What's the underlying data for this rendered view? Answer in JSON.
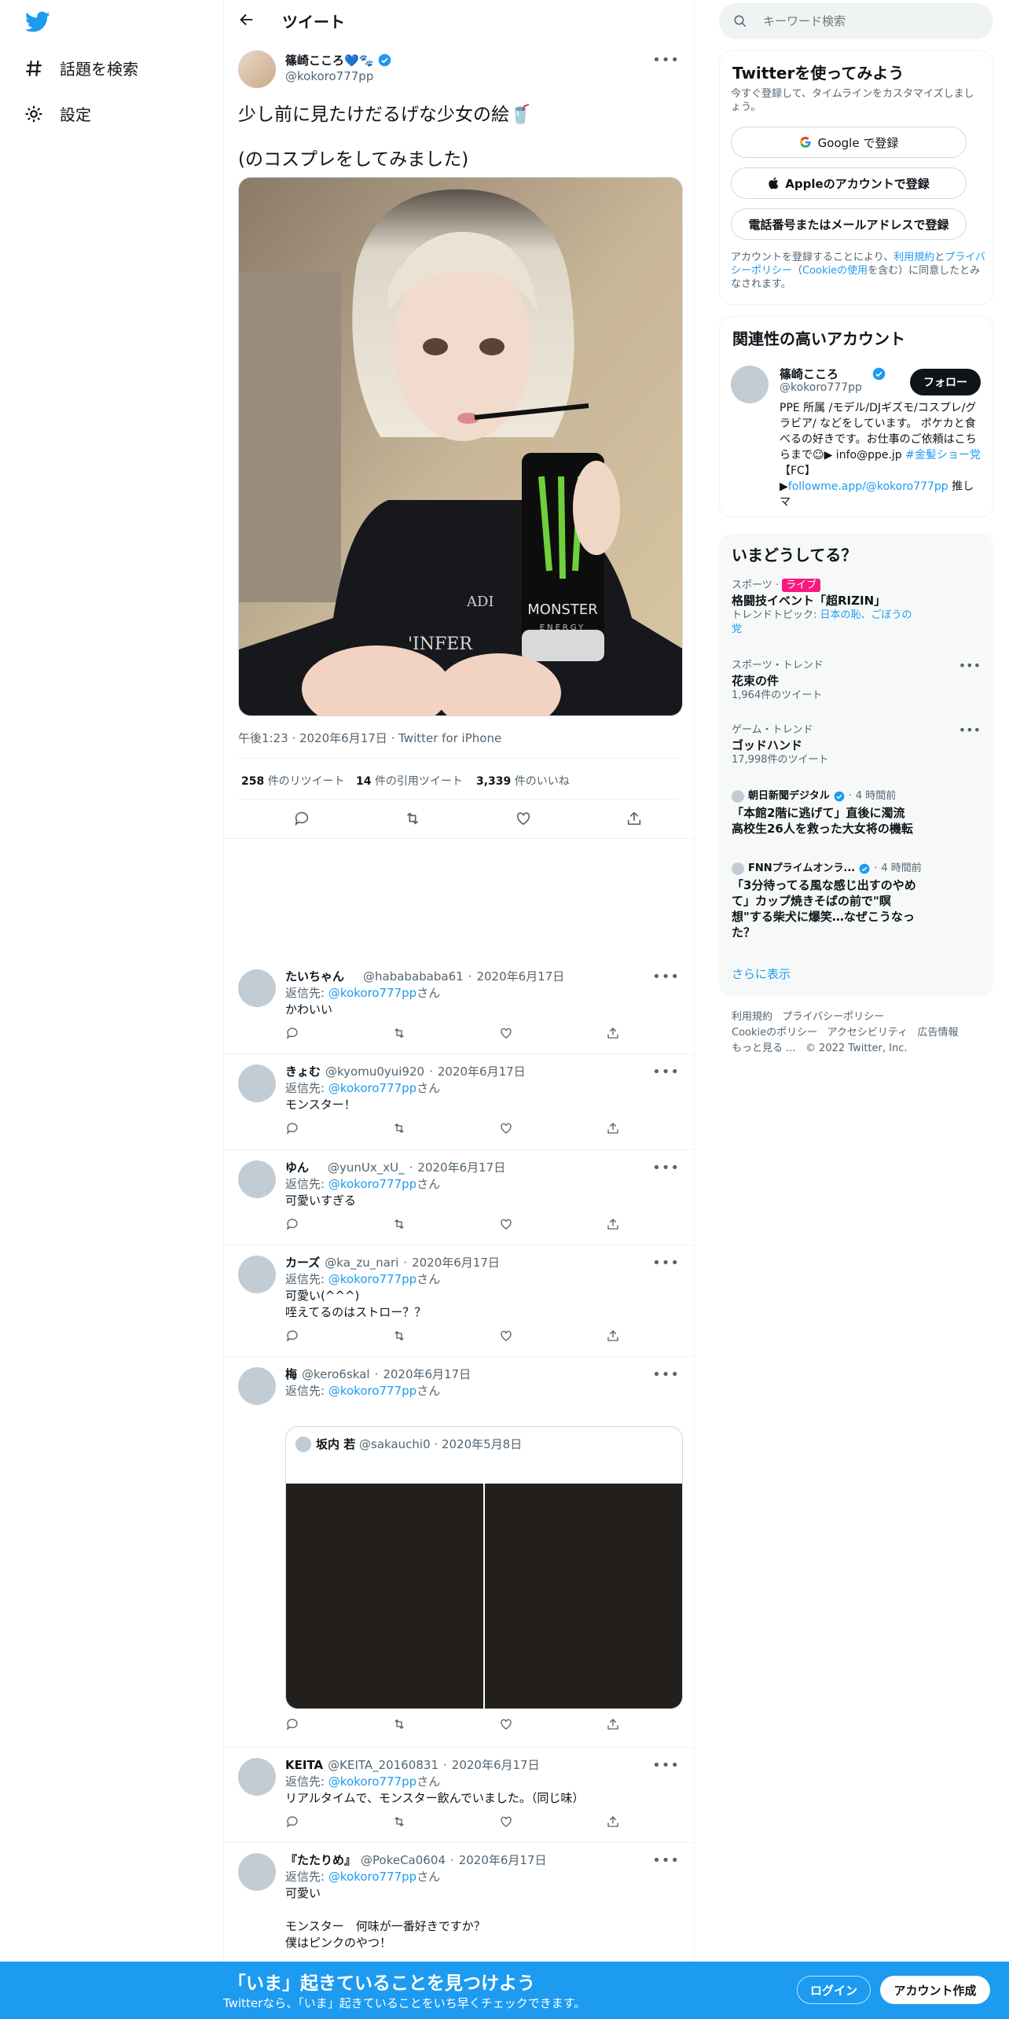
{
  "nav": {
    "explore_label": "話題を検索",
    "settings_label": "設定"
  },
  "header": {
    "title": "ツイート"
  },
  "tweet": {
    "display_name": "篠崎こころ💙🐾",
    "handle": "@kokoro777pp",
    "text_line1": "少し前に見たけだるげな少女の絵🥤",
    "text_line2": "(のコスプレをしてみました)",
    "image_text_1": "MONSTER",
    "image_text_2": "ENERGY",
    "image_text_3": "'INFER",
    "image_text_4": "ADI",
    "meta_time": "午後1:23",
    "meta_date": "2020年6月17日",
    "meta_source": "Twitter for iPhone",
    "stats": [
      {
        "count": "258",
        "label": "件のリツイート"
      },
      {
        "count": "14",
        "label": "件の引用ツイート"
      },
      {
        "count": "3,339",
        "label": "件のいいね"
      }
    ]
  },
  "replies": [
    {
      "name": "たいちゃん",
      "handle": "@hababababa61",
      "date": "2020年6月17日",
      "reply_prefix": "返信先:",
      "reply_to": "@kokoro777pp",
      "reply_suffix": "さん",
      "lines": [
        "かわいい"
      ]
    },
    {
      "name": "きょむ",
      "handle": "@kyomu0yui920",
      "date": "2020年6月17日",
      "reply_prefix": "返信先:",
      "reply_to": "@kokoro777pp",
      "reply_suffix": "さん",
      "lines": [
        "モンスター！"
      ]
    },
    {
      "name": "ゆん",
      "handle": "@yunUx_xU_",
      "date": "2020年6月17日",
      "reply_prefix": "返信先:",
      "reply_to": "@kokoro777pp",
      "reply_suffix": "さん",
      "lines": [
        "可愛いすぎる"
      ]
    },
    {
      "name": "カーズ",
      "handle": "@ka_zu_nari",
      "date": "2020年6月17日",
      "reply_prefix": "返信先:",
      "reply_to": "@kokoro777pp",
      "reply_suffix": "さん",
      "lines": [
        "可愛い(^^^)",
        "咥えてるのはストロー？？"
      ]
    },
    {
      "name": "梅",
      "handle": "@kero6skal",
      "date": "2020年6月17日",
      "reply_prefix": "返信先:",
      "reply_to": "@kokoro777pp",
      "reply_suffix": "さん",
      "lines": []
    },
    {
      "name": "KEITA",
      "handle": "@KEITA_20160831",
      "date": "2020年6月17日",
      "reply_prefix": "返信先:",
      "reply_to": "@kokoro777pp",
      "reply_suffix": "さん",
      "lines": [
        "リアルタイムで、モンスター飲んでいました。（同じ味）"
      ]
    },
    {
      "name": "『たたりめ』",
      "handle": "@PokeCa0604",
      "date": "2020年6月17日",
      "reply_prefix": "返信先:",
      "reply_to": "@kokoro777pp",
      "reply_suffix": "さん",
      "lines": [
        "可愛い",
        "",
        "モンスター　何味が一番好きですか？",
        "僕はピンクのやつ！"
      ]
    }
  ],
  "quoted": {
    "name": "坂内 若",
    "handle": "@sakauchi0",
    "date": "2020年5月8日"
  },
  "search": {
    "placeholder": "キーワード検索"
  },
  "signup": {
    "title": "Twitterを使ってみよう",
    "subtitle": "今すぐ登録して、タイムラインをカスタマイズしましょう。",
    "google_label": "Google で登録",
    "apple_label": "Appleのアカウントで登録",
    "phone_label": "電話番号またはメールアドレスで登録",
    "legal_1": "アカウントを登録することにより、",
    "legal_terms": "利用規約",
    "legal_2": "と",
    "legal_privacy": "プライバシーポリシー",
    "legal_3": "（",
    "legal_cookie": "Cookieの使用",
    "legal_4": "を含む）に同意したとみなされます。"
  },
  "related": {
    "title": "関連性の高いアカウント",
    "name": "篠崎こころ",
    "handle": "@kokoro777pp",
    "follow_label": "フォロー",
    "bio_1": "PPE 所属 /モデル/DJギズモ/コスプレ/グラビア/ などをしています。 ポケカと食べるの好きです。お仕事のご依頼はこちらまで☺︎▶ info@ppe.jp ",
    "bio_hashtag": "#金髪ショー党",
    "bio_2": "【FC】▶",
    "bio_link": "followme.app/@kokoro777pp",
    "bio_3": " 推しマ"
  },
  "trends": {
    "title": "いまどうしてる？",
    "items": [
      {
        "category": "スポーツ",
        "badge": "ライブ",
        "title": "格闘技イベント「超RIZIN」",
        "topic_prefix": "トレンドトピック:",
        "topic_links": "日本の恥、ごぼうの党"
      },
      {
        "category": "スポーツ・トレンド",
        "title": "花束の件",
        "count": "1,964件のツイート"
      },
      {
        "category": "ゲーム・トレンド",
        "title": "ゴッドハンド",
        "count": "17,998件のツイート"
      }
    ],
    "news": [
      {
        "source": "朝日新聞デジタル",
        "age": "4 時間前",
        "title": "「本館2階に逃げて」直後に濁流　高校生26人を救った大女将の機転"
      },
      {
        "source": "FNNプライムオンラ...",
        "age": "4 時間前",
        "title": "「3分待ってる風な感じ出すのやめて」カップ焼きそばの前で\"瞑想\"する柴犬に爆笑…なぜこうなった？"
      }
    ],
    "show_more": "さらに表示"
  },
  "footer": {
    "terms": "利用規約",
    "privacy": "プライバシーポリシー",
    "cookie": "Cookieのポリシー",
    "accessibility": "アクセシビリティ",
    "ads": "広告情報",
    "more": "もっと見る ...",
    "copyright": "© 2022 Twitter, Inc."
  },
  "bottom_bar": {
    "title": "「いま」起きていることを見つけよう",
    "subtitle": "Twitterなら、「いま」起きていることをいち早くチェックできます。",
    "login_label": "ログイン",
    "signup_label": "アカウント作成"
  },
  "colors": {
    "accent": "#1d9bf0",
    "text": "#0f1419",
    "muted": "#536471",
    "live": "#f91880"
  }
}
